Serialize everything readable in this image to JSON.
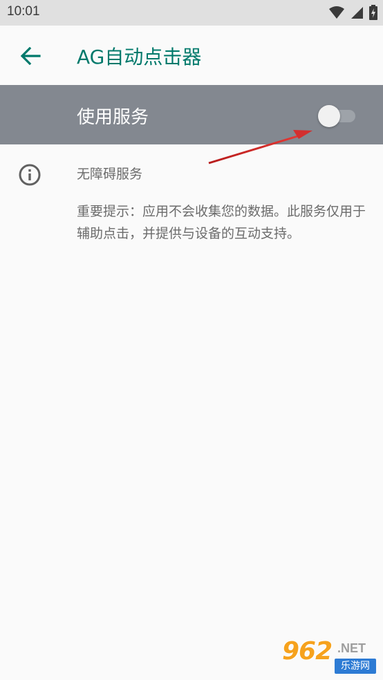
{
  "status_bar": {
    "time": "10:01",
    "icons": [
      "wifi-icon",
      "signal-icon",
      "battery-charging-icon"
    ]
  },
  "app_bar": {
    "back_icon": "arrow-back-icon",
    "title": "AG自动点击器"
  },
  "service": {
    "label": "使用服务",
    "toggle_on": false
  },
  "accessibility": {
    "icon": "info-icon",
    "title": "无障碍服务",
    "description": "重要提示：应用不会收集您的数据。此服务仅用于辅助点击，并提供与设备的互动支持。"
  },
  "watermark": {
    "number": "962",
    "net": ".NET",
    "subtitle": "乐游网"
  },
  "colors": {
    "accent": "#00796b",
    "service_row_bg": "#838890",
    "annotation_arrow": "#d32f2f",
    "background": "#fafafa"
  }
}
